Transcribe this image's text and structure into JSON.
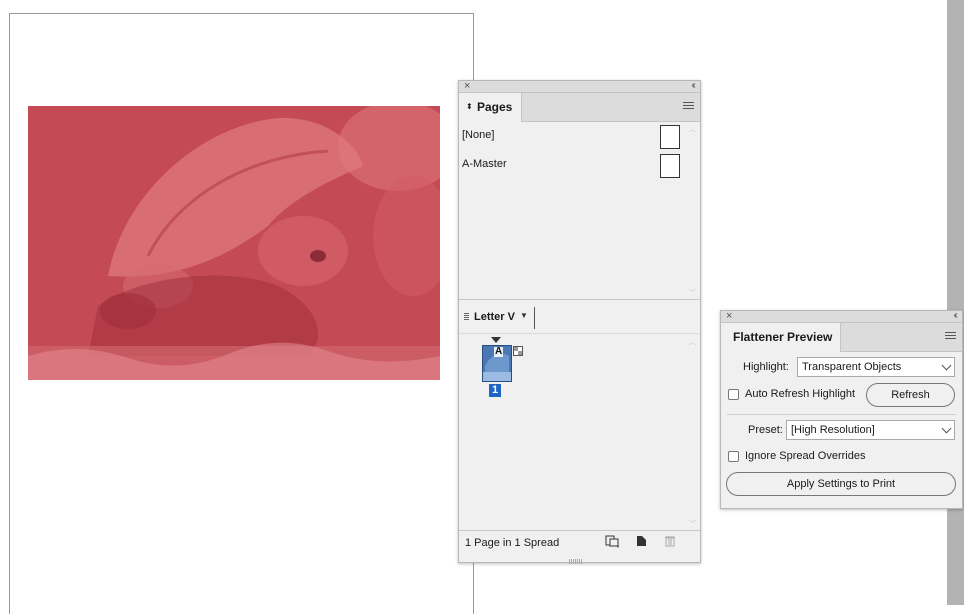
{
  "pages_panel": {
    "tab_label": "Pages",
    "masters": [
      {
        "label": "[None]"
      },
      {
        "label": "A-Master"
      }
    ],
    "view_label": "Letter V",
    "page_thumb_master_prefix": "A",
    "page_number": "1",
    "status": "1 Page in 1 Spread",
    "icons": [
      "edit-page-size-icon",
      "new-page-icon",
      "trash-icon"
    ]
  },
  "flattener_panel": {
    "tab_label": "Flattener Preview",
    "highlight_label": "Highlight:",
    "highlight_value": "Transparent Objects",
    "auto_refresh_label": "Auto Refresh Highlight",
    "auto_refresh_checked": false,
    "refresh_button": "Refresh",
    "preset_label": "Preset:",
    "preset_value": "[High Resolution]",
    "ignore_spread_label": "Ignore Spread Overrides",
    "ignore_spread_checked": false,
    "apply_button": "Apply Settings to Print"
  },
  "colors": {
    "photo_tint": "#c44a55",
    "selection_blue": "#1f63c5",
    "panel_bg": "#f0f0f0"
  }
}
